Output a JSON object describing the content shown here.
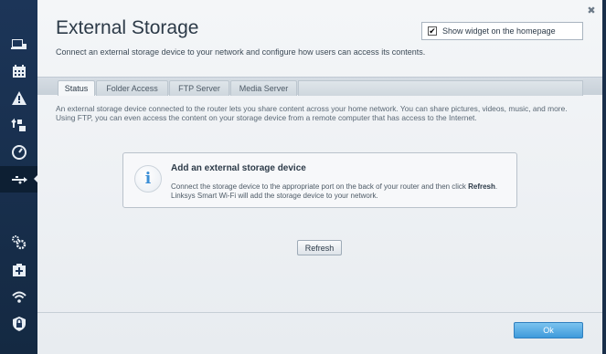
{
  "window": {
    "title": "External Storage",
    "subtitle": "Connect an external storage device to your network and configure how users can access its contents.",
    "close_glyph": "✖"
  },
  "widget": {
    "checked": true,
    "label": "Show widget on the homepage"
  },
  "tabs": [
    {
      "label": "Status",
      "active": true
    },
    {
      "label": "Folder Access",
      "active": false
    },
    {
      "label": "FTP Server",
      "active": false
    },
    {
      "label": "Media Server",
      "active": false
    }
  ],
  "description": "An external storage device connected to the router lets you share content across your home network. You can share pictures, videos, music, and more. Using FTP, you can even access the content on your storage device from a remote computer that has access to the Internet.",
  "info_card": {
    "icon": "info-icon",
    "icon_glyph": "i",
    "title": "Add an external storage device",
    "text_before": "Connect the storage device to the appropriate port on the back of your router and then click ",
    "text_bold": "Refresh",
    "text_after": ".",
    "text_line2": "Linksys Smart Wi-Fi will add the storage device to your network."
  },
  "buttons": {
    "refresh": "Refresh",
    "ok": "Ok"
  },
  "nav": {
    "items": [
      {
        "name": "device-list-icon"
      },
      {
        "name": "parental-controls-icon"
      },
      {
        "name": "troubleshooting-icon"
      },
      {
        "name": "media-prioritization-icon"
      },
      {
        "name": "speed-test-icon"
      },
      {
        "name": "external-storage-icon",
        "active": true
      },
      {
        "name": "connectivity-icon"
      },
      {
        "name": "guest-access-icon"
      },
      {
        "name": "wireless-icon"
      },
      {
        "name": "security-icon"
      }
    ]
  },
  "colors": {
    "nav_bg": "#1c3558",
    "ok_button": "#3e9adb",
    "info_icon": "#3b8fd6"
  }
}
